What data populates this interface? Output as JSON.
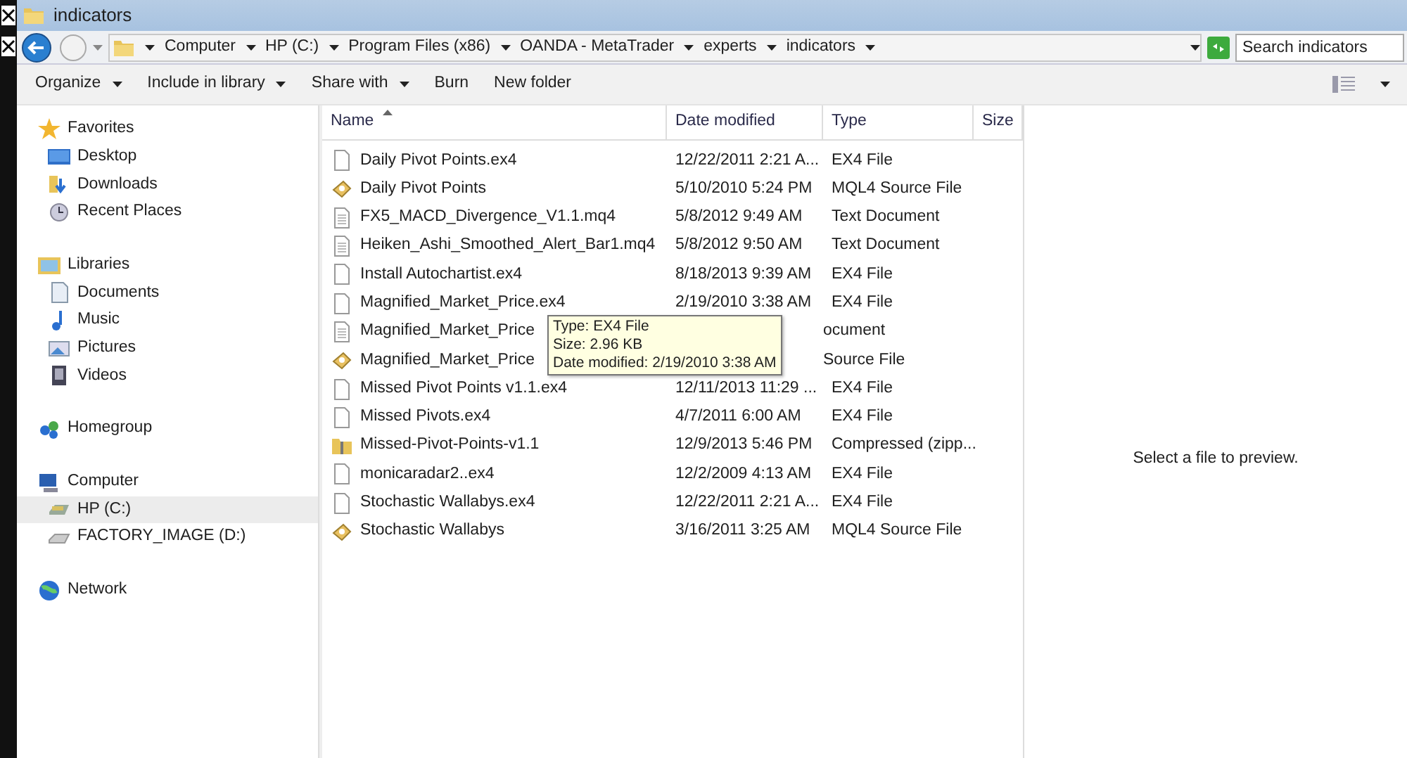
{
  "window": {
    "title": "indicators"
  },
  "address_bar": {
    "segments": [
      "Computer",
      "HP (C:)",
      "Program Files (x86)",
      "OANDA - MetaTrader",
      "experts",
      "indicators"
    ]
  },
  "search": {
    "placeholder": "Search indicators"
  },
  "toolbar": [
    {
      "label": "Organize",
      "dropdown": true
    },
    {
      "label": "Include in library",
      "dropdown": true
    },
    {
      "label": "Share with",
      "dropdown": true
    },
    {
      "label": "Burn",
      "dropdown": false
    },
    {
      "label": "New folder",
      "dropdown": false
    }
  ],
  "sidebar": {
    "groups": [
      {
        "label": "Favorites",
        "kind": "star",
        "children": [
          {
            "label": "Desktop",
            "kind": "desktop",
            "selected": false
          },
          {
            "label": "Downloads",
            "kind": "downloads",
            "selected": false
          },
          {
            "label": "Recent Places",
            "kind": "recent",
            "selected": false
          }
        ]
      },
      {
        "label": "Libraries",
        "kind": "library",
        "children": [
          {
            "label": "Documents",
            "kind": "documents",
            "selected": false
          },
          {
            "label": "Music",
            "kind": "music",
            "selected": false
          },
          {
            "label": "Pictures",
            "kind": "pictures",
            "selected": false
          },
          {
            "label": "Videos",
            "kind": "videos",
            "selected": false
          }
        ]
      },
      {
        "label": "Homegroup",
        "kind": "homegroup"
      },
      {
        "label": "Computer",
        "kind": "computer",
        "children": [
          {
            "label": "HP (C:)",
            "kind": "drive",
            "selected": true
          },
          {
            "label": "FACTORY_IMAGE (D:)",
            "kind": "disc",
            "selected": false
          }
        ]
      },
      {
        "label": "Network",
        "kind": "network"
      }
    ]
  },
  "table": {
    "columns": [
      "Name",
      "Date modified",
      "Type",
      "Size"
    ],
    "rows": [
      {
        "kind": "blank",
        "name": "Daily Pivot Points.ex4",
        "date": "12/22/2011 2:21 A...",
        "type": "EX4 File"
      },
      {
        "kind": "source",
        "name": "Daily Pivot Points",
        "date": "5/10/2010 5:24 PM",
        "type": "MQL4 Source File"
      },
      {
        "kind": "text",
        "name": "FX5_MACD_Divergence_V1.1.mq4",
        "date": "5/8/2012 9:49 AM",
        "type": "Text Document"
      },
      {
        "kind": "text",
        "name": "Heiken_Ashi_Smoothed_Alert_Bar1.mq4",
        "date": "5/8/2012 9:50 AM",
        "type": "Text Document"
      },
      {
        "kind": "blank",
        "name": "Install Autochartist.ex4",
        "date": "8/18/2013 9:39 AM",
        "type": "EX4 File"
      },
      {
        "kind": "blank",
        "name": "Magnified_Market_Price.ex4",
        "date": "2/19/2010 3:38 AM",
        "type": "EX4 File"
      },
      {
        "kind": "text",
        "name": "Magnified_Market_Price",
        "type": "ocument"
      },
      {
        "kind": "source",
        "name": "Magnified_Market_Price",
        "type": "Source File"
      },
      {
        "kind": "blank",
        "name": "Missed Pivot Points v1.1.ex4",
        "date": "12/11/2013 11:29 ...",
        "type": "EX4 File"
      },
      {
        "kind": "blank",
        "name": "Missed Pivots.ex4",
        "date": "4/7/2011 6:00 AM",
        "type": "EX4 File"
      },
      {
        "kind": "archive",
        "name": "Missed-Pivot-Points-v1.1",
        "date": "12/9/2013 5:46 PM",
        "type": "Compressed (zipp..."
      },
      {
        "kind": "blank",
        "name": "monicaradar2..ex4",
        "date": "12/2/2009 4:13 AM",
        "type": "EX4 File"
      },
      {
        "kind": "blank",
        "name": "Stochastic Wallabys.ex4",
        "date": "12/22/2011 2:21 A...",
        "type": "EX4 File"
      },
      {
        "kind": "source",
        "name": "Stochastic Wallabys",
        "date": "3/16/2011 3:25 AM",
        "type": "MQL4 Source File"
      }
    ]
  },
  "tooltip": {
    "lines": [
      "Type: EX4 File",
      "Size: 2.96 KB",
      "Date modified: 2/19/2010 3:38 AM"
    ]
  },
  "preview": {
    "message": "Select a file to preview."
  }
}
